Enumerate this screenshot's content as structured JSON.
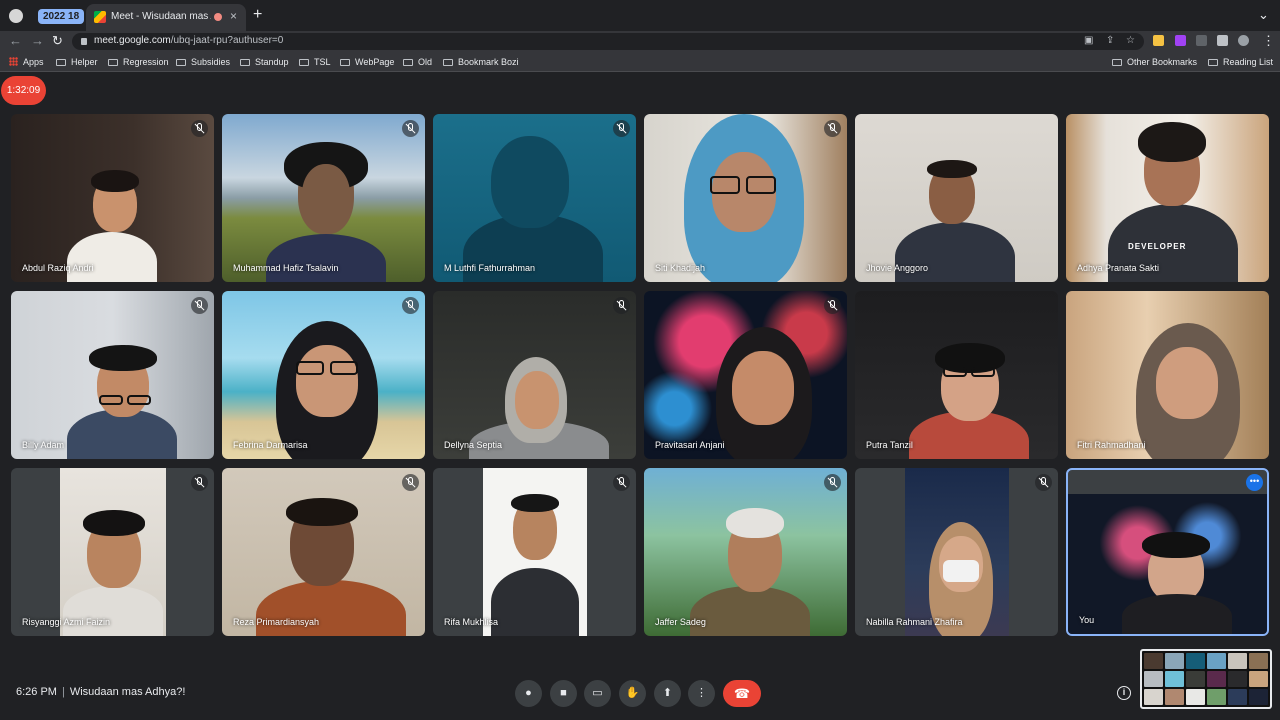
{
  "browser": {
    "tab_group_label": "2022 18",
    "active_tab_title": "Meet - Wisudaan mas Adhya",
    "url_domain": "meet.google.com",
    "url_path": "/ubq-jaat-rpu?authuser=0",
    "bookmarks": [
      "Apps",
      "Helper",
      "Regression",
      "Subsidies",
      "Standup",
      "TSL",
      "WebPage",
      "Old",
      "Bookmark Bozi"
    ],
    "other_bookmarks": "Other Bookmarks",
    "reading_list": "Reading List"
  },
  "meeting": {
    "elapsed": "1:32:09",
    "time": "6:26 PM",
    "title": "Wisudaan mas Adhya?!",
    "participants": [
      "Abdul Raziq Andri",
      "Muhammad Hafiz Tsalavin",
      "M Luthfi Fathurrahman",
      "Siti Khadijah",
      "Jhovie Anggoro",
      "Adhya Pranata Sakti",
      "Billy Adam",
      "Febrina Darmarisa",
      "Dellyna Septia",
      "Pravitasari Anjani",
      "Putra Tanzil",
      "Fitri Rahmadhani",
      "Risyanggi Azmi Faizin",
      "Reza Primardiansyah",
      "Rifa Mukhlisa",
      "Jaffer Sadeg",
      "Nabilla Rahmani Zhafira",
      "You"
    ],
    "shirt_text": "DEVELOPER"
  },
  "icons": {
    "close": "×",
    "new_tab": "+",
    "back": "←",
    "forward": "→",
    "reload": "↻",
    "more_dots": "•••",
    "mic": "🎙",
    "end_call": "☎",
    "info": "i"
  }
}
